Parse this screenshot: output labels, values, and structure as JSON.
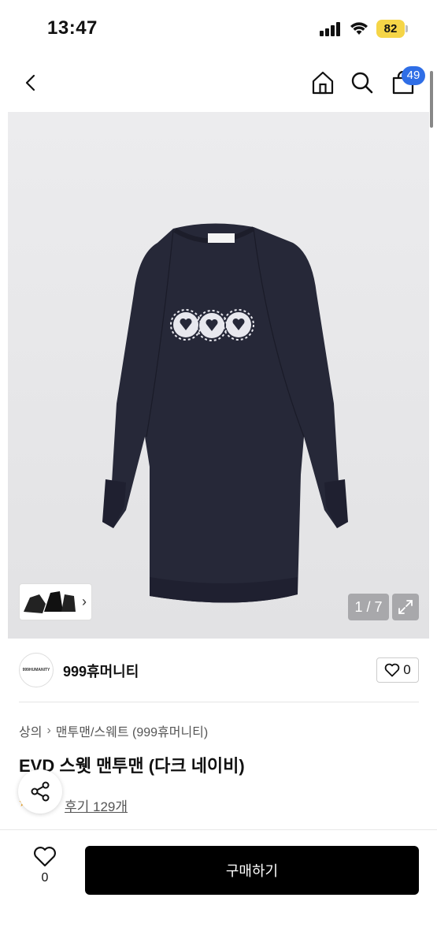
{
  "status_bar": {
    "time": "13:47",
    "battery": "82"
  },
  "nav": {
    "cart_count": "49"
  },
  "gallery": {
    "page_indicator": "1 / 7",
    "thumbnail_chevron": "›"
  },
  "seller": {
    "avatar_text": "999HUMANITY",
    "name": "999휴머니티",
    "like_count": "0"
  },
  "product": {
    "breadcrumb": [
      "상의",
      "맨투맨/스웨트 (999휴머니티)"
    ],
    "breadcrumb_sep": "›",
    "title": "EVD 스웻 맨투맨 (다크 네이비)",
    "review_link": "후기 129개"
  },
  "bottom_bar": {
    "wish_count": "0",
    "buy_label": "구매하기"
  },
  "colors": {
    "badge": "#2f6ee6",
    "battery": "#f5d547",
    "buy_button": "#000000",
    "sweatshirt": "#262838"
  },
  "icons": [
    "back-icon",
    "home-icon",
    "search-icon",
    "cart-icon",
    "expand-icon",
    "heart-icon",
    "share-icon"
  ]
}
